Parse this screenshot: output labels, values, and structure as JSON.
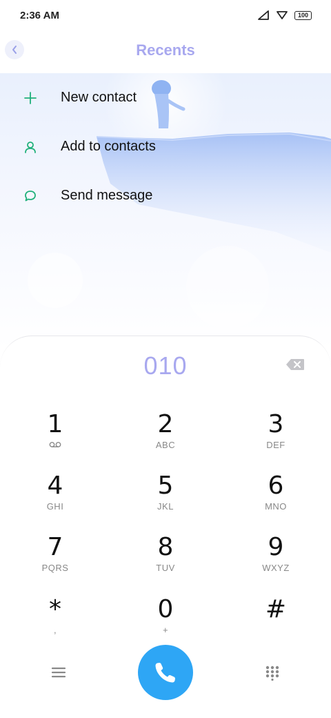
{
  "status_bar": {
    "time": "2:36 AM",
    "battery": "100",
    "icons": [
      "signal-icon",
      "wifi-icon",
      "battery-icon"
    ]
  },
  "header": {
    "title": "Recents",
    "back_icon": "chevron-left-icon"
  },
  "actions": [
    {
      "label": "New contact",
      "icon": "plus-icon"
    },
    {
      "label": "Add to contacts",
      "icon": "person-icon"
    },
    {
      "label": "Send message",
      "icon": "chat-bubble-icon"
    }
  ],
  "dialer": {
    "number": "010",
    "keys": [
      {
        "digit": "1",
        "letters": ""
      },
      {
        "digit": "2",
        "letters": "ABC"
      },
      {
        "digit": "3",
        "letters": "DEF"
      },
      {
        "digit": "4",
        "letters": "GHI"
      },
      {
        "digit": "5",
        "letters": "JKL"
      },
      {
        "digit": "6",
        "letters": "MNO"
      },
      {
        "digit": "7",
        "letters": "PQRS"
      },
      {
        "digit": "8",
        "letters": "TUV"
      },
      {
        "digit": "9",
        "letters": "WXYZ"
      },
      {
        "digit": "*",
        "letters": ","
      },
      {
        "digit": "0",
        "letters": "+"
      },
      {
        "digit": "#",
        "letters": ""
      }
    ]
  },
  "colors": {
    "accent": "#a8a8ef",
    "call_button": "#2ea6f5",
    "action_icon": "#1fb07a"
  }
}
